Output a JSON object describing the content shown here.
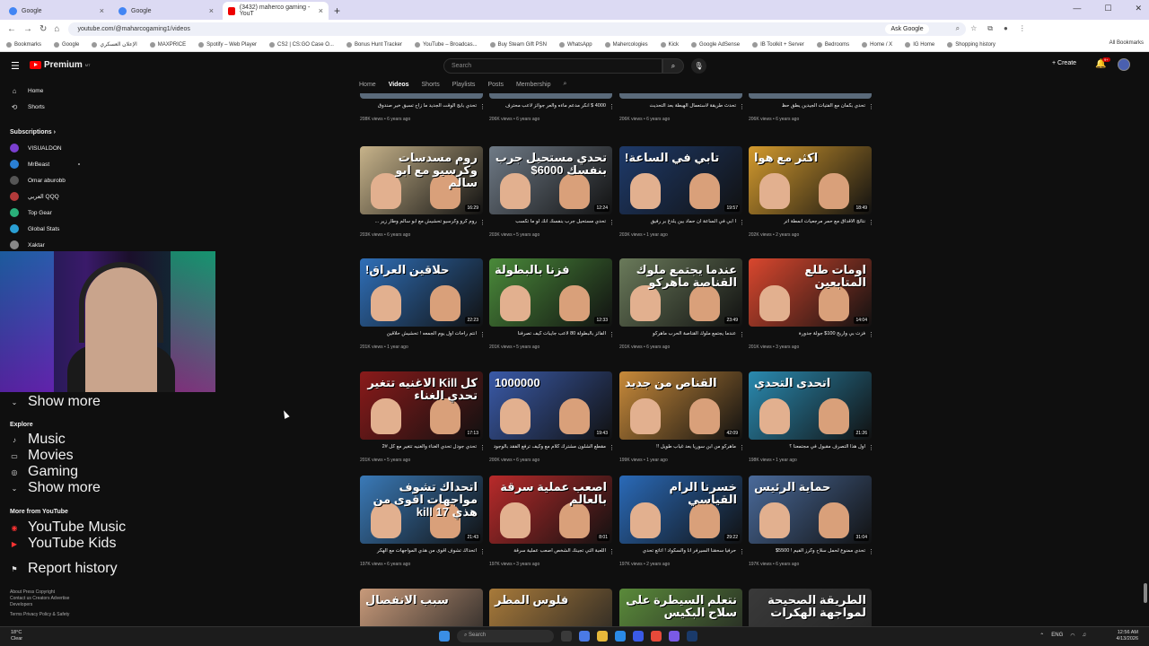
{
  "browser": {
    "tabs": [
      {
        "title": "Google",
        "icon": "google-icon"
      },
      {
        "title": "Google",
        "icon": "google-icon"
      },
      {
        "title": "(3432) maherco gaming - YouT",
        "icon": "youtube-icon"
      }
    ],
    "url": "youtube.com/@maharcogaming1/videos",
    "ask_google": "Ask Google",
    "bookmarks": [
      "Bookmarks",
      "Google",
      "الإعلان العسكري",
      "MAXPRICE",
      "Spotify – Web Player",
      "CS2 | CS:GO Case O...",
      "Bonus Hunt Tracker",
      "YouTube – Broadcas...",
      "Buy Steam Gift PSN",
      "WhatsApp",
      "Mahercologies",
      "Kick",
      "Google AdSense",
      "IB Toolkit + Server",
      "Bedrooms",
      "Home / X",
      "IG Home",
      "Shopping history"
    ],
    "all_bookmarks": "All Bookmarks"
  },
  "header": {
    "logo_text": "Premium",
    "logo_sup": "MT",
    "search_placeholder": "Search",
    "create_label": "Create",
    "notif_count": "9+"
  },
  "sidebar": {
    "home": "Home",
    "shorts": "Shorts",
    "subscriptions": "Subscriptions",
    "subs": [
      {
        "name": "VISUALDON",
        "color": "#7a3fcf"
      },
      {
        "name": "MrBeast",
        "color": "#2a7fd4"
      },
      {
        "name": "Omar aburobb",
        "color": "#555555"
      },
      {
        "name": "العربي QQQ",
        "color": "#b33a3a"
      },
      {
        "name": "Top Gear",
        "color": "#2ab07a"
      },
      {
        "name": "Global Stats",
        "color": "#2a9fd4"
      },
      {
        "name": "Xaktar",
        "color": "#888888"
      }
    ],
    "show_more_1": "Show more",
    "explore": "Explore",
    "explore_items": [
      "Music",
      "Movies",
      "Gaming"
    ],
    "show_more_2": "Show more",
    "more_from": "More from YouTube",
    "yt_music": "YouTube Music",
    "yt_kids": "YouTube Kids",
    "report_history": "Report history",
    "footer1": "About  Press  Copyright",
    "footer2": "Contact us  Creators  Advertise",
    "footer3": "Developers",
    "footer4": "Terms  Privacy  Policy & Safety"
  },
  "channel_tabs": [
    "Home",
    "Videos",
    "Shorts",
    "Playlists",
    "Posts",
    "Membership"
  ],
  "active_tab": "Videos",
  "top_row": [
    {
      "title": "تحدي بابج الوقت الجديد ما زاح تسبق خير صندوق",
      "meta": "208K views • 6 years ago"
    },
    {
      "title": "4000 $ انكر مدعم ماءه والعر جوائز لاعب محترف",
      "meta": "206K views • 6 years ago"
    },
    {
      "title": "تحدث طريقة لاستعمال الهبطة بعد التحديث",
      "meta": "206K views • 6 years ago"
    },
    {
      "title": "تحدي بكمان مع الفتيات الجيدين يطق حظ",
      "meta": "206K views • 6 years ago"
    }
  ],
  "videos": [
    {
      "thumb_text": "روم مسدسات وكرسيو مع ابو سالم",
      "duration": "16:29",
      "title": "روم كرو وكرسيو تحشيش مع ابو سالم وطار زير ...",
      "meta": "203K views • 6 years ago",
      "bg": "#c7b38a"
    },
    {
      "thumb_text": "تحدي مستحيل جرب بنفسك 6000$",
      "duration": "12:24",
      "title": "تحدي مستحيل جرب بنفسك انك لو ما تكسب",
      "meta": "203K views • 5 years ago",
      "bg": "#6f7a86"
    },
    {
      "thumb_text": "تابي في الساعة!",
      "duration": "19:57",
      "title": "ا ابي في الساعة ان حماد بين يلدغ بر رفيق",
      "meta": "203K views • 1 year ago",
      "bg": "#1e3a6a"
    },
    {
      "thumb_text": "اكثر مع هوا",
      "duration": "18:49",
      "title": "نتائج الاقداق مع حمر مرجعيات انمطة اتر",
      "meta": "202K views • 2 years ago",
      "bg": "#d39a2e"
    },
    {
      "thumb_text": "حلاقين العراق!",
      "duration": "22:23",
      "title": "انتم راحات اول يوم الجمعه ! تحشيش حلاقين",
      "meta": "201K views • 1 year ago",
      "bg": "#2f6fb8"
    },
    {
      "thumb_text": "فزنا بالبطولة",
      "duration": "12:33",
      "title": "الفائز بالبطولة 80 لاعب جايبات كيف تصرفنا",
      "meta": "201K views • 5 years ago",
      "bg": "#4a8a3a"
    },
    {
      "thumb_text": "عندما يجتمع ملوك القناصة ماهركو",
      "duration": "23:49",
      "title": "عندما يجتمع ملوك القناصة الحرب ماهركو",
      "meta": "201K views • 6 years ago",
      "bg": "#6a7a5a"
    },
    {
      "thumb_text": "اومات طلع المتابعين",
      "duration": "14:04",
      "title": "فزت بي واربح 100$ جولة جدورة",
      "meta": "201K views • 3 years ago",
      "bg": "#d9472e"
    },
    {
      "thumb_text": "كل Kill الاغنيه تتغير تحدي الغناء",
      "duration": "17:13",
      "title": "تحدي جودل تحدي الغناء والغنيه تتغير مع كل #2",
      "meta": "201K views • 5 years ago",
      "bg": "#8a1a1a"
    },
    {
      "thumb_text": "1000000",
      "duration": "19:43",
      "title": "مقطع الشلون مشترك كلام مع وكيف ترفع الفقد بالوجود",
      "meta": "200K views • 6 years ago",
      "bg": "#3a5aa8"
    },
    {
      "thumb_text": "القناص من جديد",
      "duration": "42:09",
      "title": "ماهركو من ابن سوريا بعد غياب طويل !!",
      "meta": "199K views • 1 year ago",
      "bg": "#c88a3a"
    },
    {
      "thumb_text": "اتحدى التحدي",
      "duration": "21:26",
      "title": "اول هذا التصرف مقبول في مجتمعنا ؟",
      "meta": "198K views • 1 year ago",
      "bg": "#2a8ab0"
    },
    {
      "thumb_text": "اتحداك تشوف مواجهات اقوى من هذي 17 kill",
      "duration": "21:43",
      "title": "اتحداك تشوف اقوى من هذي المواجهات مع الهكر",
      "meta": "197K views • 6 years ago",
      "bg": "#3a7ab8"
    },
    {
      "thumb_text": "اصعب عملية سرقة بالعالم",
      "duration": "8:01",
      "title": "اللعبة التي تجينك الشخص اصعب عملية سرقة",
      "meta": "197K views • 3 years ago",
      "bg": "#b82a2a"
    },
    {
      "thumb_text": "خسرنا الرام القياسي",
      "duration": "29:22",
      "title": "حرفيا سحقنا السيرفر انا والسكواد ! اتاتع تحدي",
      "meta": "197K views • 2 years ago",
      "bg": "#2a6ab8"
    },
    {
      "thumb_text": "حماية الرئيس",
      "duration": "31:04",
      "title": "تحدي ممنوع لحمل سلاح وكرز الفيم ! 5500$",
      "meta": "197K views • 6 years ago",
      "bg": "#4a6a9a"
    }
  ],
  "bottom_row_thumbs": [
    {
      "thumb_text": "سبب الانفصال",
      "bg": "#c89a7a"
    },
    {
      "thumb_text": "فلوس المطر",
      "bg": "#a87a3a"
    },
    {
      "thumb_text": "نتعلم السيطرة على سلاح البكيس",
      "bg": "#5a8a3a"
    },
    {
      "thumb_text": "الطريقة الصحيحة لمواجهة الهكرات",
      "bg": "#3a3a3a"
    }
  ],
  "taskbar": {
    "weather_temp": "18°C",
    "weather_desc": "Clear",
    "search_label": "Search",
    "lang": "ENG",
    "time": "12:56 AM",
    "date": "4/13/2026"
  }
}
